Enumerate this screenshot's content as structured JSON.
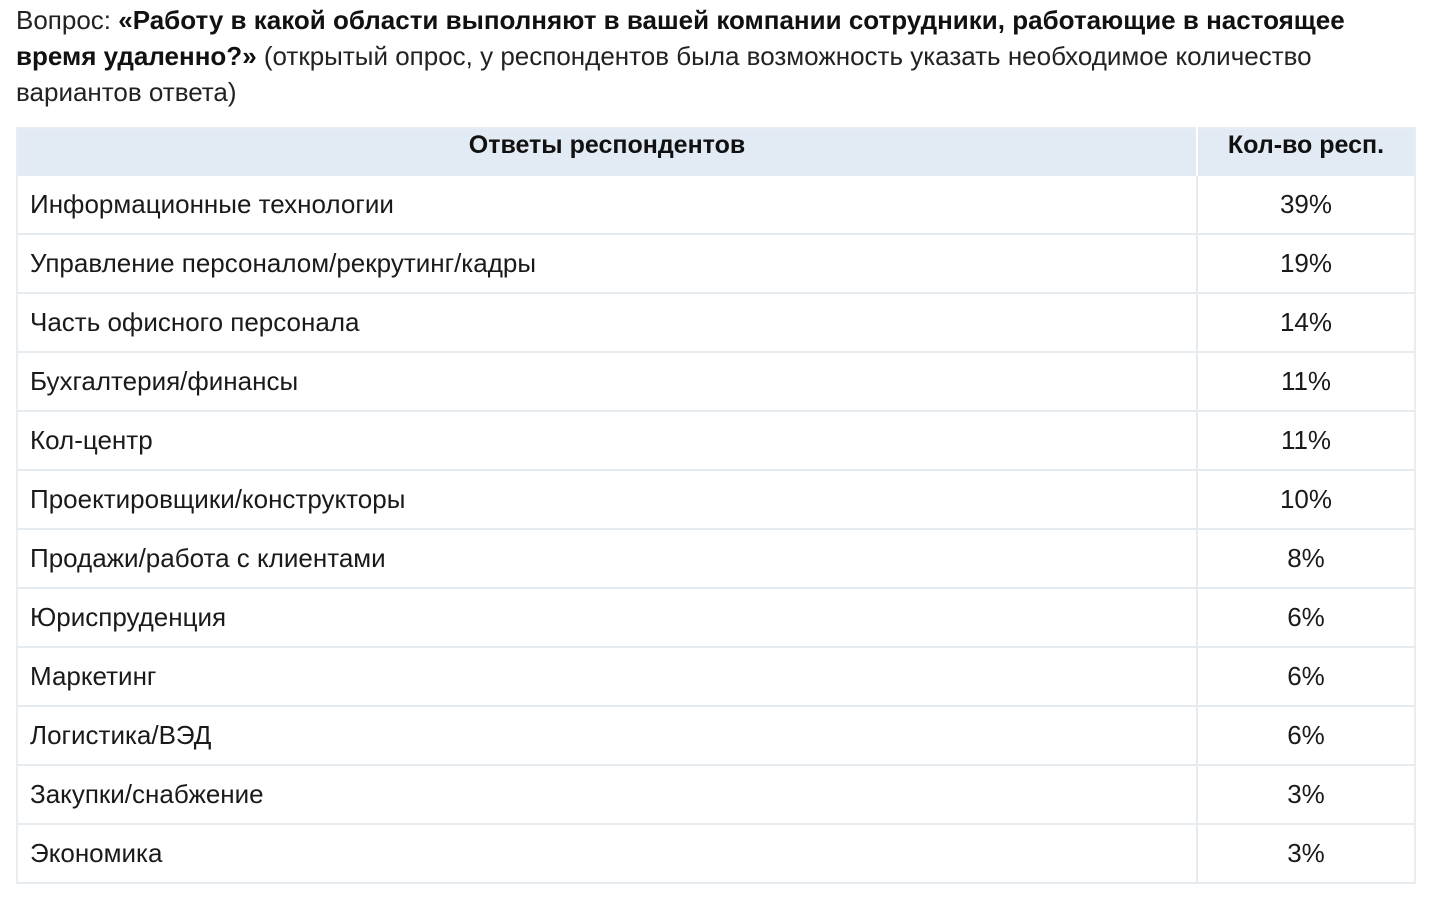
{
  "question": {
    "prefix": "Вопрос: ",
    "text": "«Работу в какой области выполняют в вашей компании сотрудники, работающие в настоящее время удаленно?»",
    "note": " (открытый опрос, у респондентов была возможность указать необходимое количество вариантов ответа)"
  },
  "table": {
    "headers": [
      "Ответы респондентов",
      "Кол-во респ."
    ],
    "rows": [
      {
        "answer": "Информационные технологии",
        "value": "39%"
      },
      {
        "answer": "Управление персоналом/рекрутинг/кадры",
        "value": "19%"
      },
      {
        "answer": "Часть офисного персонала",
        "value": "14%"
      },
      {
        "answer": "Бухгалтерия/финансы",
        "value": "11%"
      },
      {
        "answer": "Кол-центр",
        "value": "11%"
      },
      {
        "answer": "Проектировщики/конструкторы",
        "value": "10%"
      },
      {
        "answer": "Продажи/работа с клиентами",
        "value": "8%"
      },
      {
        "answer": "Юриспруденция",
        "value": "6%"
      },
      {
        "answer": "Маркетинг",
        "value": "6%"
      },
      {
        "answer": "Логистика/ВЭД",
        "value": "6%"
      },
      {
        "answer": "Закупки/снабжение",
        "value": "3%"
      },
      {
        "answer": "Экономика",
        "value": "3%"
      }
    ]
  }
}
